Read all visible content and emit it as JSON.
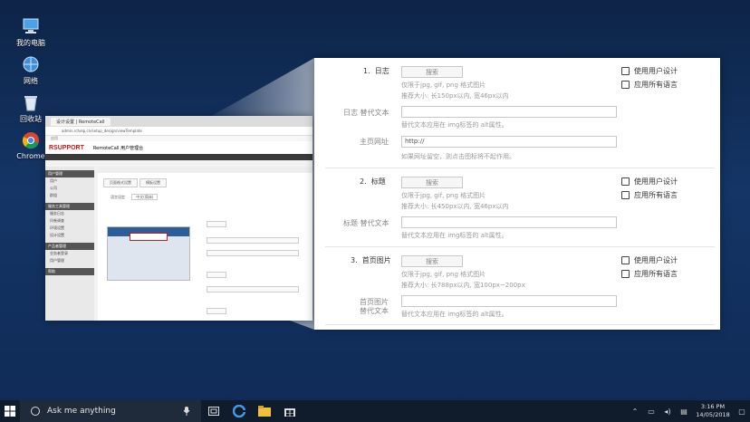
{
  "desktop": {
    "icons": [
      {
        "label": "我的电脑",
        "icon": "computer-icon"
      },
      {
        "label": "网络",
        "icon": "network-icon"
      },
      {
        "label": "回收站",
        "icon": "recycle-bin-icon"
      },
      {
        "label": "Chrome",
        "icon": "chrome-icon"
      }
    ]
  },
  "mini_browser": {
    "tab_title": "设计设置 | RemoteCall",
    "url": "admin.rchelp.cn/setup_design/viewTemplate",
    "bookmark": "应用",
    "brand": "RSUPPORT",
    "brand_sub": "RemoteCall 用户管理台",
    "sidebar": [
      {
        "type": "hd",
        "label": "用户管理"
      },
      {
        "type": "it",
        "label": "用户"
      },
      {
        "type": "it",
        "label": "公司"
      },
      {
        "type": "it",
        "label": "群组"
      },
      {
        "type": "hd",
        "label": "服务工具管理"
      },
      {
        "type": "it",
        "label": "服务日志"
      },
      {
        "type": "it",
        "label": "问卷调查"
      },
      {
        "type": "it",
        "label": "环境设置"
      },
      {
        "type": "it",
        "label": "设计设置"
      },
      {
        "type": "hd",
        "label": "产品者管理"
      },
      {
        "type": "it",
        "label": "业务者登录"
      },
      {
        "type": "it",
        "label": "用户管理"
      },
      {
        "type": "hd",
        "label": "帮助"
      }
    ],
    "tabs": [
      "页面格式设置",
      "模板设置"
    ],
    "language_label": "语言设定",
    "language_value": "中文(简体)"
  },
  "panel": {
    "sections": [
      {
        "number": "1.",
        "title": "日志",
        "search_label": "搜索",
        "format_hint": "仅限于jpg, gif, png 格式图片",
        "size_hint": "推荐大小: 长150px以内, 宽46px以内",
        "alt_label": "日志 替代文本",
        "alt_hint": "替代文本应用在 img标签的 alt属性。",
        "url_label": "主页网址",
        "url_value": "http://",
        "url_hint": "如果网址留空，则点击图标将不起作用。",
        "check_user_design": "使用用户设计",
        "check_all_lang": "应用所有语言"
      },
      {
        "number": "2.",
        "title": "标题",
        "search_label": "搜索",
        "format_hint": "仅限于jpg, gif, png 格式图片",
        "size_hint": "推荐大小: 长450px以内, 宽46px以内",
        "alt_label": "标题 替代文本",
        "alt_hint": "替代文本应用在 img标签的 alt属性。",
        "check_user_design": "使用用户设计",
        "check_all_lang": "应用所有语言"
      },
      {
        "number": "3.",
        "title": "首页图片",
        "search_label": "搜索",
        "format_hint": "仅限于jpg, gif, png 格式图片",
        "size_hint": "推荐大小: 长788px以内, 宽100px~200px",
        "alt_label_1": "首页图片",
        "alt_label_2": "替代文本",
        "alt_hint": "替代文本应用在 img标签的 alt属性。",
        "check_user_design": "使用用户设计",
        "check_all_lang": "应用所有语言"
      }
    ]
  },
  "taskbar": {
    "search_placeholder": "Ask me anything",
    "time": "3:16 PM",
    "date": "14/05/2018"
  }
}
